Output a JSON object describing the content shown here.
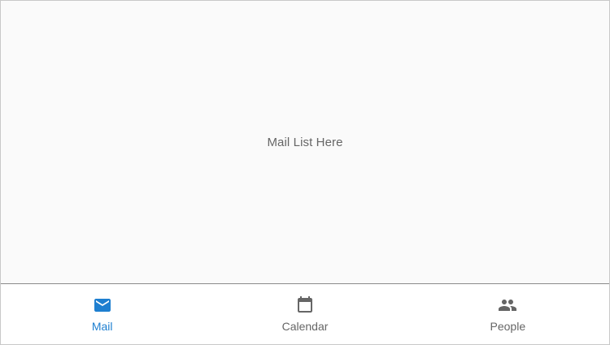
{
  "main": {
    "placeholder_text": "Mail List Here"
  },
  "bottom_nav": {
    "active_tab": "Mail",
    "tabs": [
      {
        "label": "Mail",
        "icon": "mail-icon",
        "active": true
      },
      {
        "label": "Calendar",
        "icon": "calendar-icon",
        "active": false
      },
      {
        "label": "People",
        "icon": "people-icon",
        "active": false
      }
    ]
  },
  "colors": {
    "accent": "#1e7fd0",
    "inactive": "#666666",
    "content_background": "#fafafa",
    "nav_background": "#ffffff"
  }
}
